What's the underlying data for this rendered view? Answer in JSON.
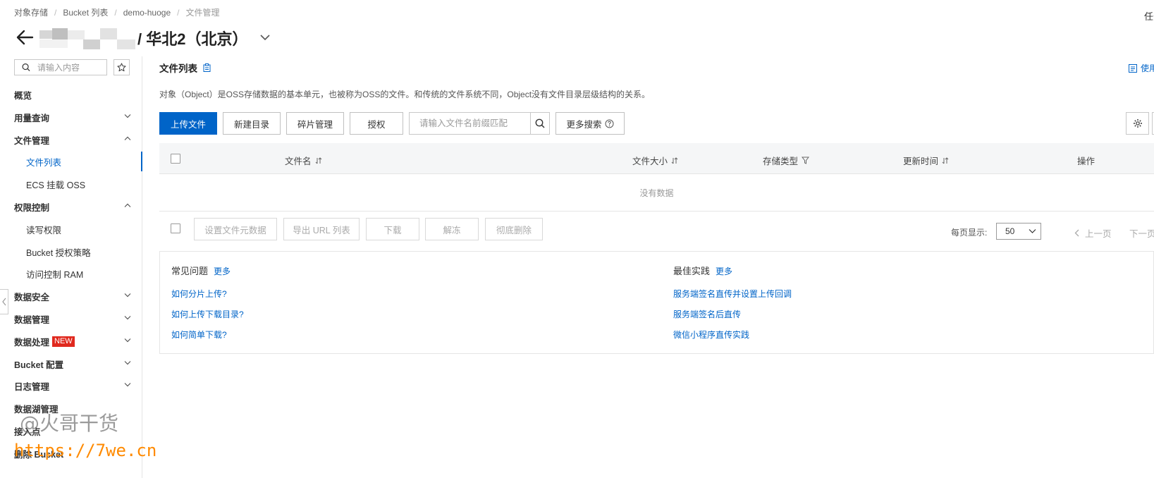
{
  "breadcrumb": [
    "对象存储",
    "Bucket 列表",
    "demo-huoge",
    "文件管理"
  ],
  "top_right_text": "任务",
  "title": "/ 华北2（北京）",
  "sidebar": {
    "search_placeholder": "请输入内容",
    "items": [
      {
        "label": "概览",
        "type": "top",
        "chevron": "none"
      },
      {
        "label": "用量查询",
        "type": "top",
        "chevron": "down"
      },
      {
        "label": "文件管理",
        "type": "top",
        "chevron": "up"
      },
      {
        "label": "文件列表",
        "type": "sub",
        "active": true
      },
      {
        "label": "ECS 挂载 OSS",
        "type": "sub"
      },
      {
        "label": "权限控制",
        "type": "top",
        "chevron": "up"
      },
      {
        "label": "读写权限",
        "type": "sub"
      },
      {
        "label": "Bucket 授权策略",
        "type": "sub"
      },
      {
        "label": "访问控制 RAM",
        "type": "sub"
      },
      {
        "label": "数据安全",
        "type": "top",
        "chevron": "down"
      },
      {
        "label": "数据管理",
        "type": "top",
        "chevron": "down"
      },
      {
        "label": "数据处理",
        "type": "top",
        "chevron": "down",
        "badge": "NEW"
      },
      {
        "label": "Bucket 配置",
        "type": "top",
        "chevron": "down"
      },
      {
        "label": "日志管理",
        "type": "top",
        "chevron": "down"
      },
      {
        "label": "数据湖管理",
        "type": "top",
        "chevron": "none"
      },
      {
        "label": "接入点",
        "type": "top",
        "chevron": "none"
      },
      {
        "label": "删除 Bucket",
        "type": "top",
        "chevron": "none"
      }
    ]
  },
  "watermark": {
    "line1": "@火哥干货",
    "line2": "https://7we.cn"
  },
  "main": {
    "section_title": "文件列表",
    "top_link": "使用",
    "description": "对象（Object）是OSS存储数据的基本单元，也被称为OSS的文件。和传统的文件系统不同，Object没有文件目录层级结构的关系。",
    "toolbar": {
      "upload": "上传文件",
      "new_dir": "新建目录",
      "fragments": "碎片管理",
      "authorize": "授权",
      "search_placeholder": "请输入文件名前缀匹配",
      "more_search": "更多搜索"
    },
    "table": {
      "columns": [
        "文件名",
        "文件大小",
        "存储类型",
        "更新时间",
        "操作"
      ],
      "empty_text": "没有数据"
    },
    "bulk": {
      "set_meta": "设置文件元数据",
      "export_url": "导出 URL 列表",
      "download": "下载",
      "unfreeze": "解冻",
      "delete": "彻底删除"
    },
    "pagination": {
      "label": "每页显示:",
      "page_size": "50",
      "prev": "上一页",
      "next": "下一页"
    }
  },
  "faq": {
    "left": {
      "title": "常见问题",
      "more": "更多",
      "links": [
        "如何分片上传?",
        "如何上传下载目录?",
        "如何简单下载?"
      ]
    },
    "right": {
      "title": "最佳实践",
      "more": "更多",
      "links": [
        "服务端签名直传并设置上传回调",
        "服务端签名后直传",
        "微信小程序直传实践"
      ]
    }
  }
}
